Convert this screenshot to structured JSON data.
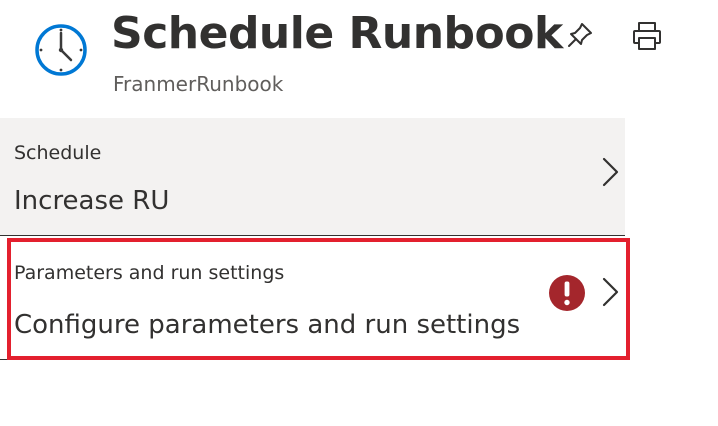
{
  "header": {
    "title": "Schedule Runbook",
    "subtitle": "FranmerRunbook",
    "icons": [
      "clock-icon",
      "pin-icon",
      "print-icon"
    ]
  },
  "rows": [
    {
      "label": "Schedule",
      "value": "Increase RU",
      "icon": "chevron-right-icon"
    },
    {
      "label": "Parameters and run settings",
      "value": "Configure parameters and run settings",
      "status_icon": "error-icon",
      "icon": "chevron-right-icon",
      "highlighted": true
    }
  ],
  "colors": {
    "highlight_border": "#e3202e",
    "error": "#a4262c",
    "clock_accent": "#0078d4",
    "selected_row_bg": "#f3f2f1"
  }
}
